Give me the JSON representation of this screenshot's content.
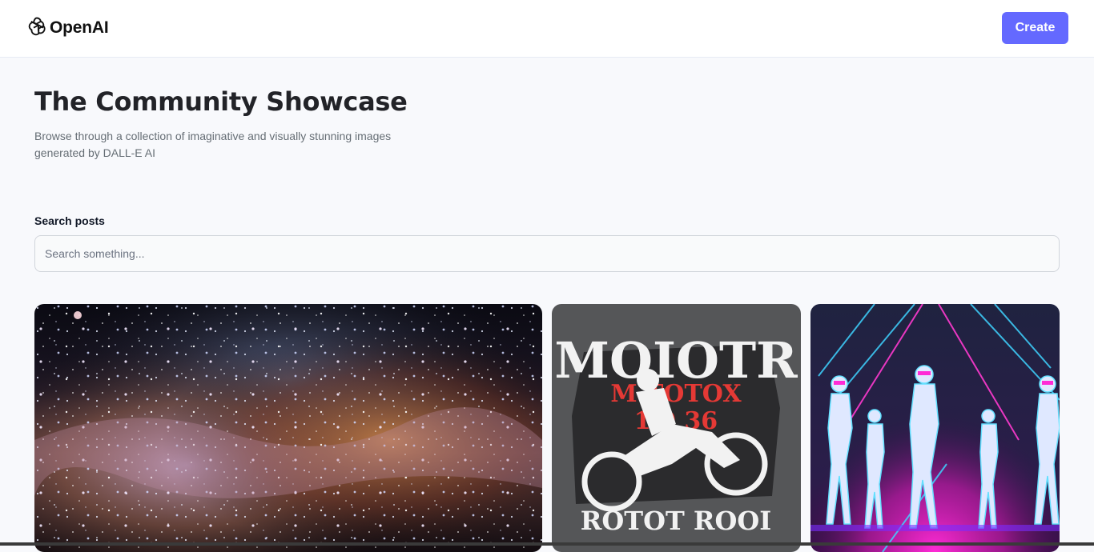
{
  "header": {
    "logo_text": "OpenAI",
    "create_label": "Create",
    "accent_color": "#6469ff"
  },
  "hero": {
    "title": "The Community Showcase",
    "subtitle": "Browse through a collection of imaginative and visually stunning images generated by DALL-E AI"
  },
  "search": {
    "label": "Search posts",
    "placeholder": "Search something...",
    "value": ""
  },
  "gallery": {
    "cards": [
      {
        "subject": "galaxy-nebula-image"
      },
      {
        "subject": "motocross-tshirt-design-image",
        "image_text_top": "MOIOTR",
        "image_text_mid": "M TOTOX",
        "image_text_num": "1 0 36",
        "image_text_bottom": "ROTOT ROOI"
      },
      {
        "subject": "neon-dancers-image"
      }
    ]
  }
}
